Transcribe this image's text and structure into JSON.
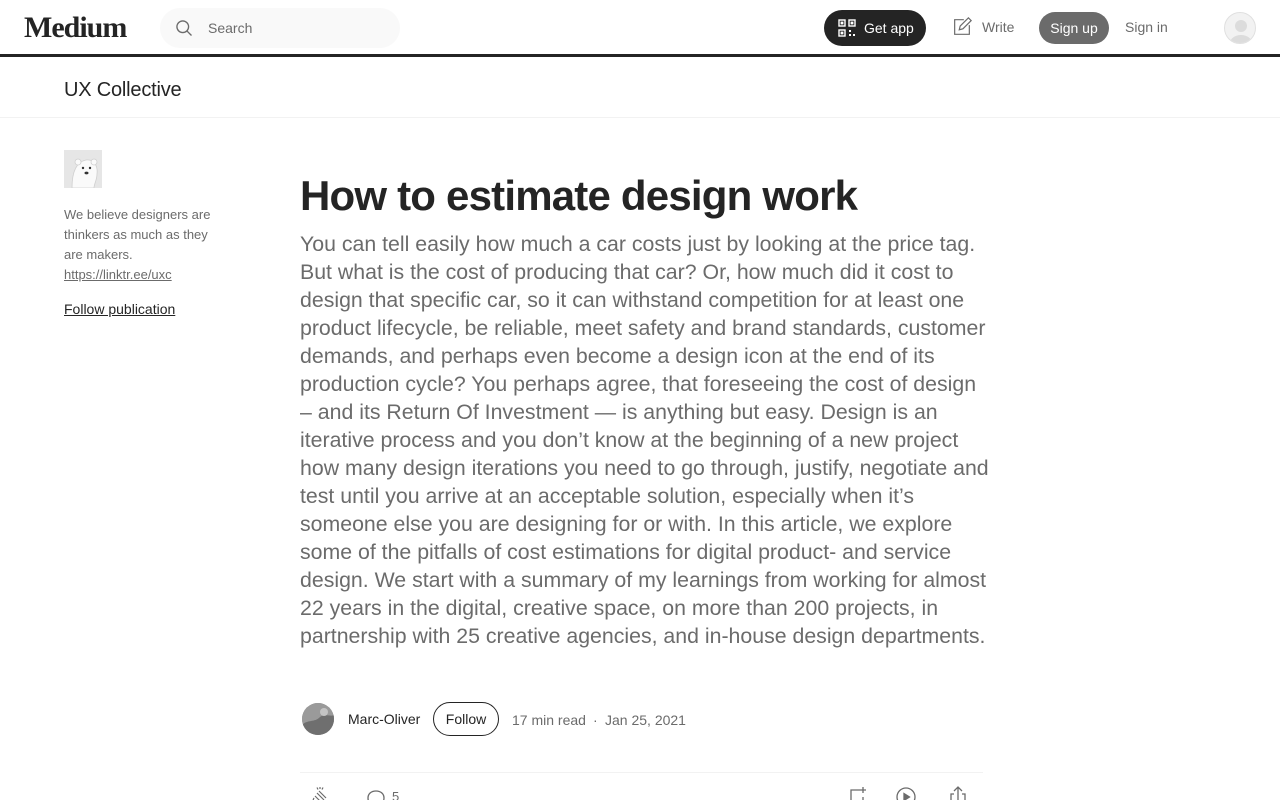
{
  "nav": {
    "logo": "Medium",
    "search_placeholder": "Search",
    "get_app": "Get app",
    "write": "Write",
    "sign_up": "Sign up",
    "sign_in": "Sign in"
  },
  "publication": {
    "name": "UX Collective",
    "description": "We believe designers are thinkers as much as they are makers.",
    "link": "https://linktr.ee/uxc",
    "follow": "Follow publication"
  },
  "article": {
    "title": "How to estimate design work",
    "subtitle": "You can tell easily how much a car costs just by looking at the price tag. But what is the cost of producing that car? Or, how much did it cost to design that specific car, so it can withstand competition for at least one product lifecycle, be reliable, meet safety and brand standards, customer demands, and perhaps even become a design icon at the end of its production cycle? You perhaps agree, that foreseeing the cost of design – and its Return Of Investment — is anything but easy. Design is an iterative process and you don’t know at the beginning of a new project how many design iterations you need to go through, justify, negotiate and test until you arrive at an acceptable solution, especially when it’s someone else you are designing for or with. In this article, we explore some of the pitfalls of cost estimations for digital product- and service design. We start with a summary of my learnings from working for almost 22 years in the digital, creative space, on more than 200 projects, in partnership with 25 creative agencies, and in-house design departments.",
    "author": "Marc-Oliver",
    "follow": "Follow",
    "read_time": "17 min read",
    "separator": "·",
    "date": "Jan 25, 2021",
    "responses": "5"
  },
  "icons": {
    "search": "search-icon",
    "qr": "qr-code-icon",
    "write": "pen-icon",
    "clap": "clap-icon",
    "comment": "comment-icon",
    "bookmark": "bookmark-add-icon",
    "listen": "play-icon",
    "share": "share-icon"
  },
  "colors": {
    "text_primary": "#242424",
    "text_secondary": "#6b6b6b",
    "signup_bg": "#6b6b6b",
    "getapp_bg": "#242424"
  }
}
